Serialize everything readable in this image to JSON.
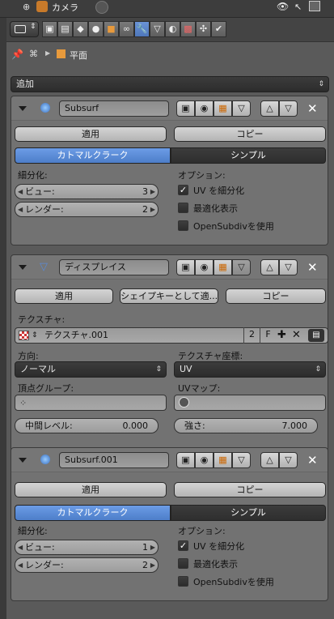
{
  "outliner": {
    "item_label": "カメラ"
  },
  "breadcrumb": {
    "object": "平面"
  },
  "add_menu": {
    "label": "追加"
  },
  "modifiers": [
    {
      "name": "Subsurf",
      "apply": "適用",
      "copy": "コピー",
      "mode_catmull": "カトマルクラーク",
      "mode_simple": "シンプル",
      "subdiv_heading": "細分化:",
      "view_label": "ビュー:",
      "view_value": "3",
      "render_label": "レンダー:",
      "render_value": "2",
      "options_heading": "オプション:",
      "uv_subdiv": "UV を細分化",
      "optimal_display": "最適化表示",
      "opensubdiv": "OpenSubdivを使用"
    },
    {
      "name": "ディスプレイス",
      "apply": "適用",
      "shape_key": "シェイプキーとして適...",
      "copy": "コピー",
      "texture_heading": "テクスチャ:",
      "texture_name": "テクスチャ.001",
      "texture_users": "2",
      "fake_user": "F",
      "direction_heading": "方向:",
      "direction_value": "ノーマル",
      "tex_coords_heading": "テクスチャ座標:",
      "tex_coords_value": "UV",
      "vgroup_heading": "頂点グループ:",
      "uvmap_heading": "UVマップ:",
      "midlevel_label": "中間レベル:",
      "midlevel_value": "0.000",
      "strength_label": "強さ:",
      "strength_value": "7.000"
    },
    {
      "name": "Subsurf.001",
      "apply": "適用",
      "copy": "コピー",
      "mode_catmull": "カトマルクラーク",
      "mode_simple": "シンプル",
      "subdiv_heading": "細分化:",
      "view_label": "ビュー:",
      "view_value": "1",
      "render_label": "レンダー:",
      "render_value": "2",
      "options_heading": "オプション:",
      "uv_subdiv": "UV を細分化",
      "optimal_display": "最適化表示",
      "opensubdiv": "OpenSubdivを使用"
    }
  ],
  "colors": {
    "accent_blue": "#5a8ad6",
    "panel_bg": "#727272",
    "wrench_tab": "#5a7fc0"
  }
}
